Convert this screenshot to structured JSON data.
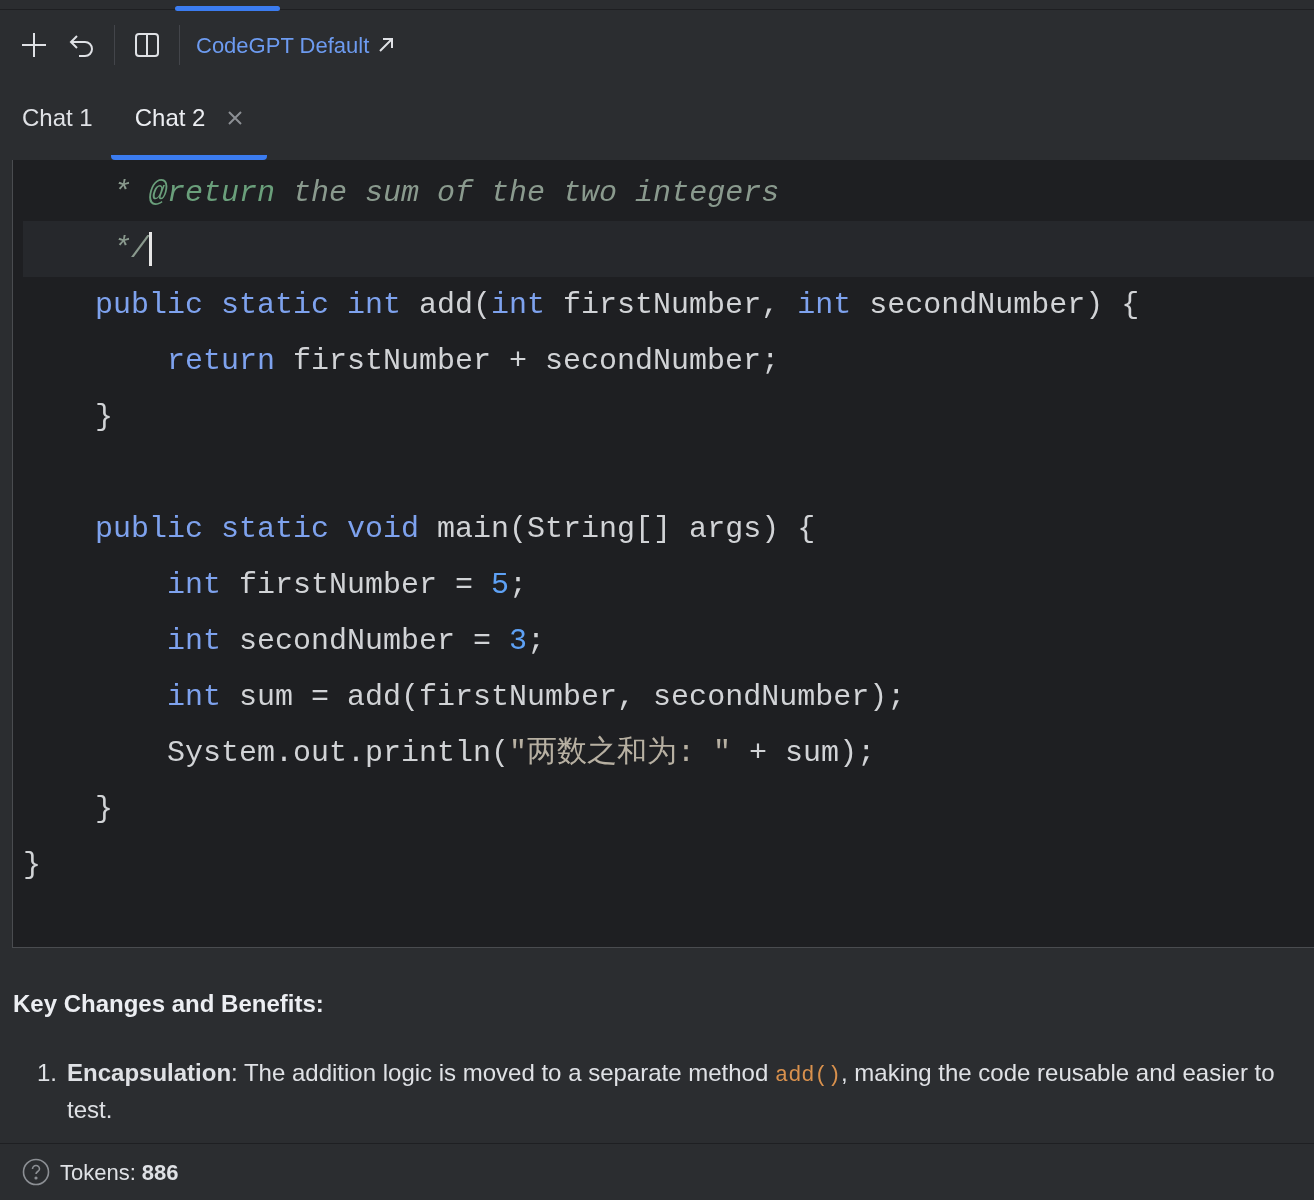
{
  "toolbar": {
    "model_link": "CodeGPT Default"
  },
  "tabs": [
    {
      "label": "Chat 1",
      "selected": false
    },
    {
      "label": "Chat 2",
      "selected": true
    }
  ],
  "code": {
    "lines": [
      {
        "current": false,
        "tokens": [
          {
            "kind": "comment",
            "text": "     * "
          },
          {
            "kind": "doctag",
            "text": "@return"
          },
          {
            "kind": "comment",
            "text": " the sum of the two integers"
          }
        ]
      },
      {
        "current": true,
        "tokens": [
          {
            "kind": "comment",
            "text": "     */"
          }
        ]
      },
      {
        "current": false,
        "tokens": [
          {
            "kind": "keyword",
            "text": "    public static int"
          },
          {
            "kind": "plain",
            "text": " add("
          },
          {
            "kind": "keyword",
            "text": "int"
          },
          {
            "kind": "plain",
            "text": " firstNumber, "
          },
          {
            "kind": "keyword",
            "text": "int"
          },
          {
            "kind": "plain",
            "text": " secondNumber) {"
          }
        ]
      },
      {
        "current": false,
        "tokens": [
          {
            "kind": "keyword",
            "text": "        return"
          },
          {
            "kind": "plain",
            "text": " firstNumber + secondNumber;"
          }
        ]
      },
      {
        "current": false,
        "tokens": [
          {
            "kind": "plain",
            "text": "    }"
          }
        ]
      },
      {
        "current": false
      },
      {
        "current": false,
        "tokens": [
          {
            "kind": "keyword",
            "text": "    public static void"
          },
          {
            "kind": "plain",
            "text": " main(String[] args) {"
          }
        ]
      },
      {
        "current": false,
        "tokens": [
          {
            "kind": "keyword",
            "text": "        int"
          },
          {
            "kind": "plain",
            "text": " firstNumber = "
          },
          {
            "kind": "number",
            "text": "5"
          },
          {
            "kind": "plain",
            "text": ";"
          }
        ]
      },
      {
        "current": false,
        "tokens": [
          {
            "kind": "keyword",
            "text": "        int"
          },
          {
            "kind": "plain",
            "text": " secondNumber = "
          },
          {
            "kind": "number",
            "text": "3"
          },
          {
            "kind": "plain",
            "text": ";"
          }
        ]
      },
      {
        "current": false,
        "tokens": [
          {
            "kind": "keyword",
            "text": "        int"
          },
          {
            "kind": "plain",
            "text": " sum = add(firstNumber, secondNumber);"
          }
        ]
      },
      {
        "current": false,
        "tokens": [
          {
            "kind": "plain",
            "text": "        System.out.println("
          },
          {
            "kind": "string",
            "text": "\"两数之和为: \""
          },
          {
            "kind": "plain",
            "text": " + sum);"
          }
        ]
      },
      {
        "current": false,
        "tokens": [
          {
            "kind": "plain",
            "text": "    }"
          }
        ]
      },
      {
        "current": false,
        "tokens": [
          {
            "kind": "plain",
            "text": "}"
          }
        ]
      }
    ]
  },
  "response": {
    "heading": "Key Changes and Benefits:",
    "items": [
      {
        "number": "1.",
        "parts": [
          {
            "kind": "bold",
            "text": "Encapsulation"
          },
          {
            "kind": "text",
            "text": ": The addition logic is moved to a separate method "
          },
          {
            "kind": "code",
            "text": "add()"
          },
          {
            "kind": "text",
            "text": ", making the code reusable and easier to test."
          }
        ]
      }
    ]
  },
  "status_bar": {
    "label": "Tokens:",
    "value": "886"
  }
}
